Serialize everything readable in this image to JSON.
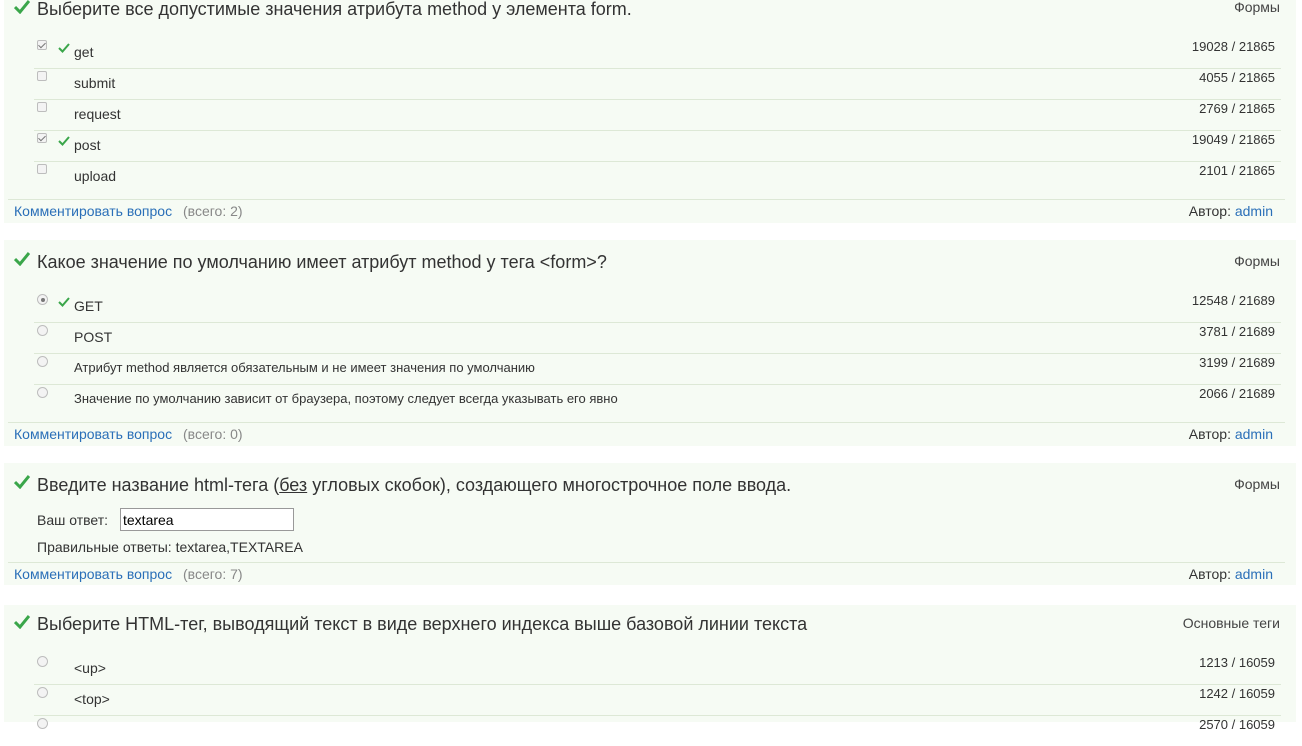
{
  "colors": {
    "block_bg": "#f6fbf4",
    "link": "#2a6fb8",
    "check_green": "#3aa64a"
  },
  "labels": {
    "comment_link": "Комментировать вопрос",
    "author_prefix": "Автор:",
    "your_answer": "Ваш ответ:",
    "correct_answers_prefix": "Правильные ответы:"
  },
  "questions": [
    {
      "title": "Выберите все допустимые значения атрибута method у элемента form.",
      "category": "Формы",
      "input_type": "checkbox",
      "options": [
        {
          "label": "get",
          "checked": true,
          "correct": true,
          "count": "19028 / 21865"
        },
        {
          "label": "submit",
          "checked": false,
          "correct": false,
          "count": "4055 / 21865"
        },
        {
          "label": "request",
          "checked": false,
          "correct": false,
          "count": "2769 / 21865"
        },
        {
          "label": "post",
          "checked": true,
          "correct": true,
          "count": "19049 / 21865"
        },
        {
          "label": "upload",
          "checked": false,
          "correct": false,
          "count": "2101 / 21865"
        }
      ],
      "comments": "(всего: 2)",
      "author": "admin"
    },
    {
      "title": "Какое значение по умолчанию имеет атрибут method у тега <form>?",
      "category": "Формы",
      "input_type": "radio",
      "options": [
        {
          "label": "GET",
          "checked": true,
          "correct": true,
          "count": "12548 / 21689"
        },
        {
          "label": "POST",
          "checked": false,
          "correct": false,
          "count": "3781 / 21689"
        },
        {
          "label": "Атрибут method является обязательным и не имеет значения по умолчанию",
          "checked": false,
          "correct": false,
          "count": "3199 / 21689"
        },
        {
          "label": "Значение по умолчанию зависит от браузера, поэтому следует всегда указывать его явно",
          "checked": false,
          "correct": false,
          "count": "2066 / 21689"
        }
      ],
      "comments": "(всего: 0)",
      "author": "admin"
    },
    {
      "title_pre": "Введите название html-тега (",
      "title_underlined": "без",
      "title_post": " угловых скобок), создающего многострочное поле ввода.",
      "category": "Формы",
      "input_type": "text",
      "answer_value": "textarea",
      "correct_answers": "textarea,TEXTAREA",
      "comments": "(всего: 7)",
      "author": "admin"
    },
    {
      "title": "Выберите HTML-тег, выводящий текст в виде верхнего индекса выше базовой линии текста",
      "category": "Основные теги",
      "input_type": "radio",
      "options": [
        {
          "label": "<up>",
          "checked": false,
          "correct": false,
          "count": "1213 / 16059"
        },
        {
          "label": "<top>",
          "checked": false,
          "correct": false,
          "count": "1242 / 16059"
        },
        {
          "label": "",
          "checked": false,
          "correct": false,
          "count": "2570 / 16059"
        }
      ]
    }
  ]
}
